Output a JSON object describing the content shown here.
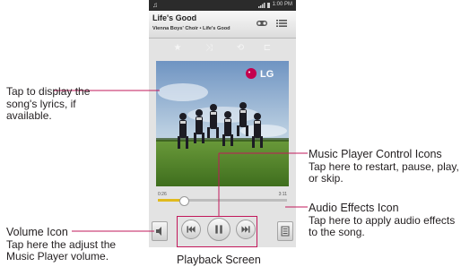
{
  "phone": {
    "status_time": "1:00 PM",
    "song_title": "Life's Good",
    "song_subtitle": "Vienna Boys' Choir • Life's Good",
    "album_logo": "LG",
    "time_elapsed": "0:26",
    "time_total": "3:11",
    "progress": 0.2,
    "icons": [
      "music-note-icon",
      "signal-icon",
      "battery-icon",
      "share-icon",
      "playlist-icon",
      "favorite-star-icon",
      "shuffle-icon",
      "repeat-icon",
      "add-to-playlist-icon",
      "volume-icon",
      "previous-icon",
      "pause-icon",
      "next-icon",
      "audio-effects-icon"
    ]
  },
  "callouts": {
    "lyrics": {
      "text": "Tap to display the song's lyrics, if available."
    },
    "volume": {
      "title": "Volume Icon",
      "text": "Tap here the adjust the Music Player volume."
    },
    "controls": {
      "title": "Music Player Control Icons",
      "text": "Tap here to restart, pause, play, or skip."
    },
    "effects": {
      "title": "Audio Effects Icon",
      "text": "Tap here to apply audio effects to the song."
    }
  },
  "caption": "Playback Screen",
  "colors": {
    "accent_line": "#c2185b",
    "progress_fill": "#e0ba1e"
  }
}
